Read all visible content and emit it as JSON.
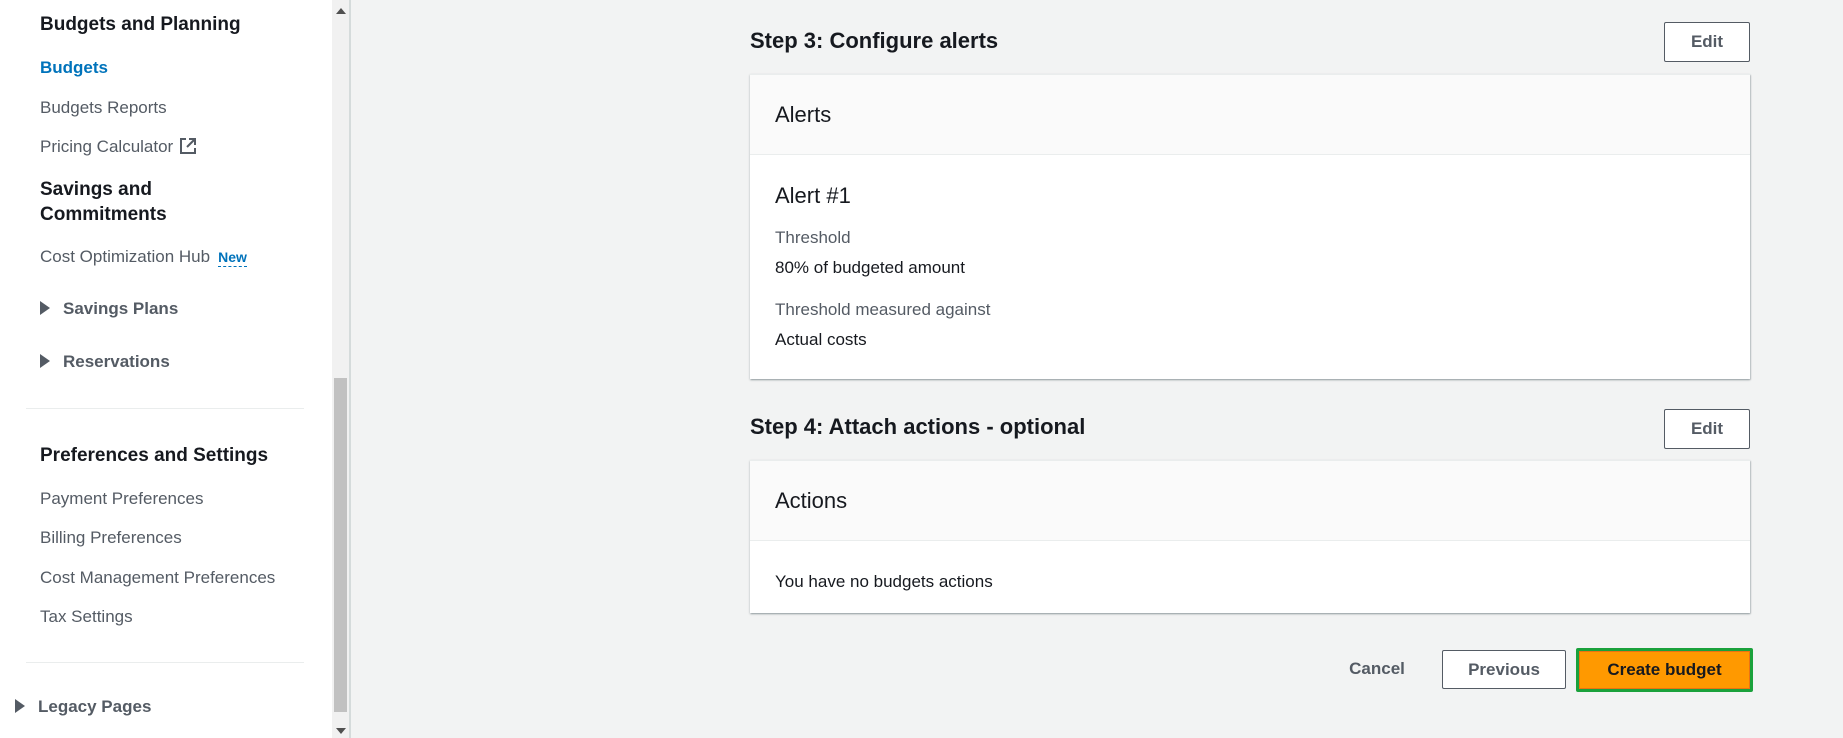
{
  "sidebar": {
    "budgets_planning_title": "Budgets and Planning",
    "budgets": "Budgets",
    "budgets_reports": "Budgets Reports",
    "pricing_calculator": "Pricing Calculator",
    "savings_title_line1": "Savings and",
    "savings_title_line2": "Commitments",
    "cost_optimization_hub": "Cost Optimization Hub",
    "new_badge": "New",
    "savings_plans": "Savings Plans",
    "reservations": "Reservations",
    "preferences_title": "Preferences and Settings",
    "payment_preferences": "Payment Preferences",
    "billing_preferences": "Billing Preferences",
    "cost_management_preferences": "Cost Management Preferences",
    "tax_settings": "Tax Settings",
    "legacy_pages": "Legacy Pages"
  },
  "step3": {
    "title": "Step 3: Configure alerts",
    "edit_label": "Edit",
    "card_header": "Alerts",
    "alert_title": "Alert #1",
    "threshold_label": "Threshold",
    "threshold_value": "80% of budgeted amount",
    "measured_label": "Threshold measured against",
    "measured_value": "Actual costs"
  },
  "step4": {
    "title": "Step 4: Attach actions - optional",
    "edit_label": "Edit",
    "card_header": "Actions",
    "empty_text": "You have no budgets actions"
  },
  "footer": {
    "cancel": "Cancel",
    "previous": "Previous",
    "create": "Create budget"
  },
  "colors": {
    "accent_link": "#0073bb",
    "primary_button": "#ff9900",
    "focus_ring": "#1aa13b"
  }
}
